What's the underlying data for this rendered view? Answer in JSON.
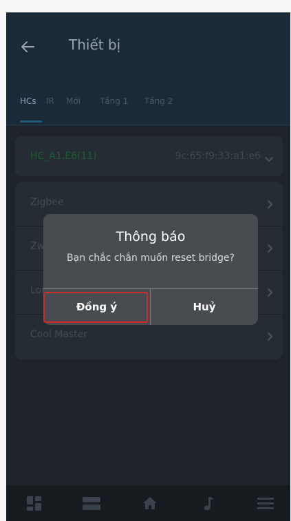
{
  "header": {
    "title": "Thiết bị"
  },
  "tabs": [
    "HCs",
    "IR",
    "Mới",
    "Tầng 1",
    "Tầng 2"
  ],
  "hc": {
    "name": "HC_A1.E6(11)",
    "mac": "9c:65:f9:33:a1:e6"
  },
  "list": [
    "Zigbee",
    "Zwave",
    "Lora",
    "Cool Master"
  ],
  "dialog": {
    "title": "Thông báo",
    "message": "Bạn chắc chắn muốn reset bridge?",
    "ok": "Đồng ý",
    "cancel": "Huỷ"
  },
  "bottom_nav": [
    "dashboard-icon",
    "devices-icon",
    "home-icon",
    "music-icon",
    "menu-icon"
  ]
}
